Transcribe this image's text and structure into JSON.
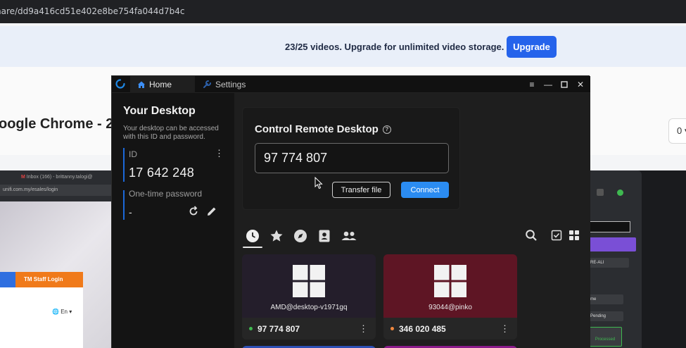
{
  "background": {
    "url_fragment": "hare/dd9a416cd51e402e8be754fa044d7b4c",
    "banner_text": "23/25 videos. Upgrade for unlimited video storage.",
    "upgrade_label": "Upgrade",
    "page_heading": "oogle Chrome - 2",
    "right_box_text": "0",
    "left_browser_tab": "Inbox (166) - brittanny.talogi@",
    "left_browser_url": "unifi.com.my/esales/login",
    "login_tab_label": "TM Staff Login",
    "language_label": "En",
    "right_app_items": [
      "RE-ALI",
      "me",
      "Pending",
      "Processed"
    ]
  },
  "app": {
    "tabs": [
      {
        "label": "Home",
        "icon": "home-icon"
      },
      {
        "label": "Settings",
        "icon": "wrench-icon"
      }
    ],
    "window_controls": [
      "menu-icon",
      "minimize-icon",
      "maximize-icon",
      "close-icon"
    ],
    "your_desktop": {
      "title": "Your Desktop",
      "description": "Your desktop can be accessed with this ID and password.",
      "id_label": "ID",
      "id_value": "17 642 248",
      "password_label": "One-time password",
      "password_value": "-"
    },
    "control": {
      "title": "Control Remote Desktop",
      "id_input_value": "97 774 807",
      "transfer_label": "Transfer file",
      "connect_label": "Connect"
    },
    "peer_tabs": [
      "recent-icon",
      "favorites-icon",
      "discovered-icon",
      "address-book-icon",
      "group-icon"
    ],
    "peers": [
      {
        "hostname": "AMD@desktop-v1971gq",
        "id": "97 774 807",
        "status_color": "#3fb950",
        "thumb_color": "#241e2b"
      },
      {
        "hostname": "93044@pinko",
        "id": "346 020 485",
        "status_color": "#f0883e",
        "thumb_color": "#5e1524"
      }
    ],
    "colors": {
      "accent": "#2b8cf2",
      "upgrade": "#2563eb"
    }
  }
}
